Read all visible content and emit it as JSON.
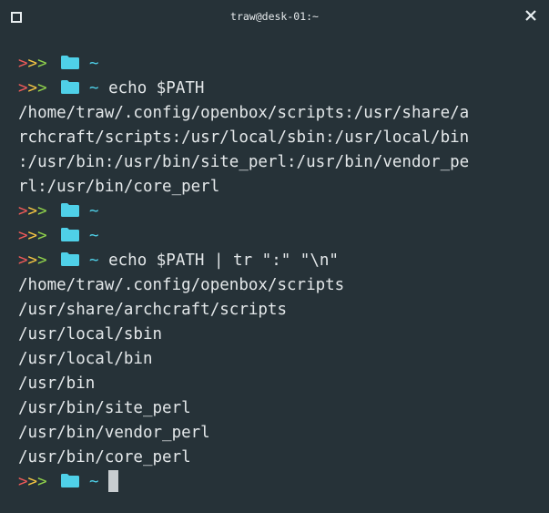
{
  "window": {
    "title": "traw@desk-01:~"
  },
  "prompt": {
    "arrows": [
      ">",
      ">",
      ">"
    ],
    "dir": "~",
    "colors": {
      "arrow1": "#ef5a58",
      "arrow2": "#f4c542",
      "arrow3": "#8fd14b",
      "folder": "#4fd0e8",
      "tilde": "#4fd0e8"
    },
    "folder_icon": "folder-icon"
  },
  "lines": [
    {
      "type": "prompt",
      "command": ""
    },
    {
      "type": "prompt",
      "command": "echo $PATH"
    },
    {
      "type": "output",
      "text": "/home/traw/.config/openbox/scripts:/usr/share/a"
    },
    {
      "type": "output",
      "text": "rchcraft/scripts:/usr/local/sbin:/usr/local/bin"
    },
    {
      "type": "output",
      "text": ":/usr/bin:/usr/bin/site_perl:/usr/bin/vendor_pe"
    },
    {
      "type": "output",
      "text": "rl:/usr/bin/core_perl"
    },
    {
      "type": "prompt",
      "command": ""
    },
    {
      "type": "prompt",
      "command": ""
    },
    {
      "type": "prompt",
      "command": "echo $PATH | tr \":\" \"\\n\""
    },
    {
      "type": "output",
      "text": "/home/traw/.config/openbox/scripts"
    },
    {
      "type": "output",
      "text": "/usr/share/archcraft/scripts"
    },
    {
      "type": "output",
      "text": "/usr/local/sbin"
    },
    {
      "type": "output",
      "text": "/usr/local/bin"
    },
    {
      "type": "output",
      "text": "/usr/bin"
    },
    {
      "type": "output",
      "text": "/usr/bin/site_perl"
    },
    {
      "type": "output",
      "text": "/usr/bin/vendor_perl"
    },
    {
      "type": "output",
      "text": "/usr/bin/core_perl"
    },
    {
      "type": "prompt",
      "command": "",
      "cursor": true
    }
  ]
}
